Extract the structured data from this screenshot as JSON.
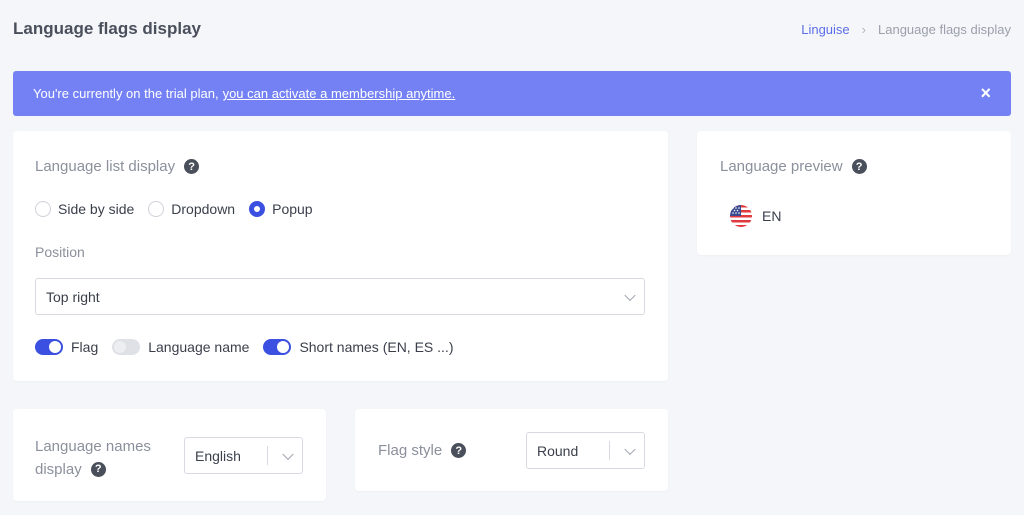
{
  "header": {
    "title": "Language flags display",
    "breadcrumb": {
      "root": "Linguise",
      "separator": "›",
      "current": "Language flags display"
    }
  },
  "banner": {
    "text": "You're currently on the trial plan,",
    "link": "you can activate a membership anytime.",
    "close": "×",
    "color": "#7481f5"
  },
  "list_display": {
    "label": "Language list display",
    "help": "?",
    "options": [
      {
        "label": "Side by side",
        "checked": false
      },
      {
        "label": "Dropdown",
        "checked": false
      },
      {
        "label": "Popup",
        "checked": true
      }
    ],
    "position_label": "Position",
    "position_value": "Top right",
    "toggles": [
      {
        "label": "Flag",
        "on": true
      },
      {
        "label": "Language name",
        "on": false
      },
      {
        "label": "Short names (EN, ES ...)",
        "on": true
      }
    ]
  },
  "preview": {
    "label": "Language preview",
    "help": "?",
    "lang": "EN"
  },
  "names_display": {
    "label_line1": "Language names",
    "label_line2": "display",
    "help": "?",
    "value": "English"
  },
  "flag_style": {
    "label": "Flag style",
    "help": "?",
    "value": "Round"
  },
  "accent": "#3b4fe0"
}
